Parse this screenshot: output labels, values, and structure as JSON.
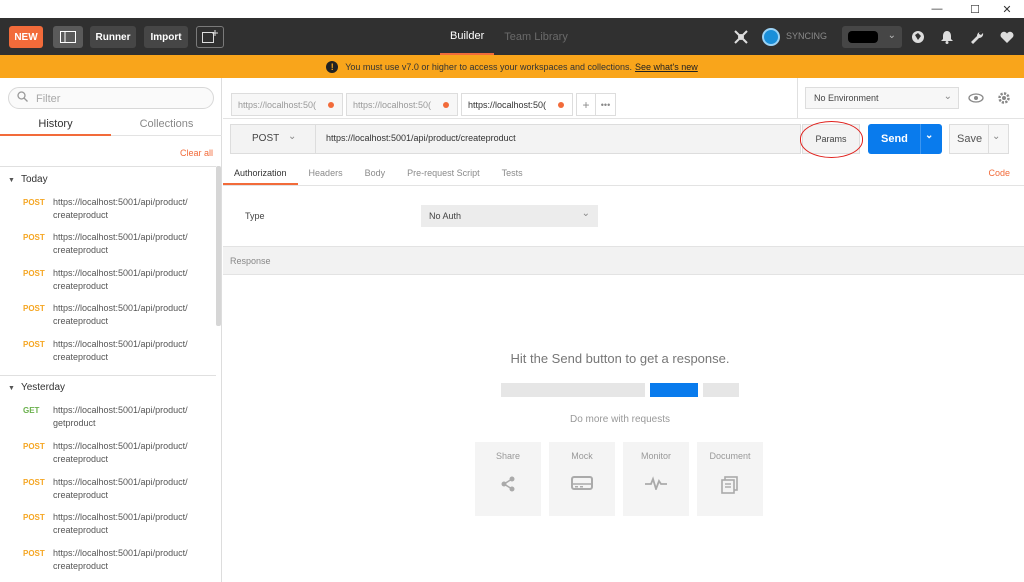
{
  "window": {
    "minimize_glyph": "—",
    "maximize_glyph": "☐",
    "close_glyph": "✕"
  },
  "header": {
    "new_label": "NEW",
    "runner_label": "Runner",
    "import_label": "Import",
    "tabs": [
      {
        "label": "Builder",
        "active": true
      },
      {
        "label": "Team Library",
        "active": false
      }
    ],
    "sync_label": "SYNCING",
    "icons": [
      "satellite-icon",
      "sync-icon",
      "user-avatar-icon",
      "globe-icon",
      "bell-icon",
      "wrench-icon",
      "heart-icon"
    ]
  },
  "banner": {
    "message": "You must use v7.0 or higher to access your workspaces and collections.",
    "link": "See what's new"
  },
  "sidebar": {
    "filter_placeholder": "Filter",
    "tabs": [
      {
        "label": "History",
        "active": true
      },
      {
        "label": "Collections",
        "active": false
      }
    ],
    "clear_all": "Clear all",
    "groups": [
      {
        "title": "Today",
        "items": [
          {
            "method": "POST",
            "url_line1": "https://localhost:5001/api/product/",
            "url_line2": "createproduct"
          },
          {
            "method": "POST",
            "url_line1": "https://localhost:5001/api/product/",
            "url_line2": "createproduct"
          },
          {
            "method": "POST",
            "url_line1": "https://localhost:5001/api/product/",
            "url_line2": "createproduct"
          },
          {
            "method": "POST",
            "url_line1": "https://localhost:5001/api/product/",
            "url_line2": "createproduct"
          },
          {
            "method": "POST",
            "url_line1": "https://localhost:5001/api/product/",
            "url_line2": "createproduct"
          }
        ]
      },
      {
        "title": "Yesterday",
        "items": [
          {
            "method": "GET",
            "url_line1": "https://localhost:5001/api/product/",
            "url_line2": "getproduct"
          },
          {
            "method": "POST",
            "url_line1": "https://localhost:5001/api/product/",
            "url_line2": "createproduct"
          },
          {
            "method": "POST",
            "url_line1": "https://localhost:5001/api/product/",
            "url_line2": "createproduct"
          },
          {
            "method": "POST",
            "url_line1": "https://localhost:5001/api/product/",
            "url_line2": "createproduct"
          },
          {
            "method": "POST",
            "url_line1": "https://localhost:5001/api/product/",
            "url_line2": "createproduct"
          }
        ]
      }
    ]
  },
  "request_tabs": [
    {
      "label": "https://localhost:50(",
      "active": false
    },
    {
      "label": "https://localhost:50(",
      "active": false
    },
    {
      "label": "https://localhost:50(",
      "active": true
    }
  ],
  "request_tab_add": "+",
  "request_tab_more": "•••",
  "environment": {
    "selected": "No Environment"
  },
  "request": {
    "method": "POST",
    "url": "https://localhost:5001/api/product/createproduct",
    "params_label": "Params",
    "send_label": "Send",
    "save_label": "Save"
  },
  "sub_tabs": [
    {
      "label": "Authorization",
      "active": true
    },
    {
      "label": "Headers",
      "active": false
    },
    {
      "label": "Body",
      "active": false
    },
    {
      "label": "Pre-request Script",
      "active": false
    },
    {
      "label": "Tests",
      "active": false
    }
  ],
  "code_link": "Code",
  "auth": {
    "type_label": "Type",
    "selected": "No Auth"
  },
  "response": {
    "heading": "Response",
    "hint": "Hit the Send button to get a response.",
    "do_more": "Do more with requests",
    "cards": [
      {
        "label": "Share",
        "icon": "share-icon"
      },
      {
        "label": "Mock",
        "icon": "mock-server-icon"
      },
      {
        "label": "Monitor",
        "icon": "monitor-pulse-icon"
      },
      {
        "label": "Document",
        "icon": "document-icon"
      }
    ]
  },
  "colors": {
    "accent": "#f26b3a",
    "send_blue": "#097bed",
    "banner": "#f9a51b",
    "header_bg": "#303030",
    "post": "#f5a623",
    "get": "#6ab04c"
  }
}
